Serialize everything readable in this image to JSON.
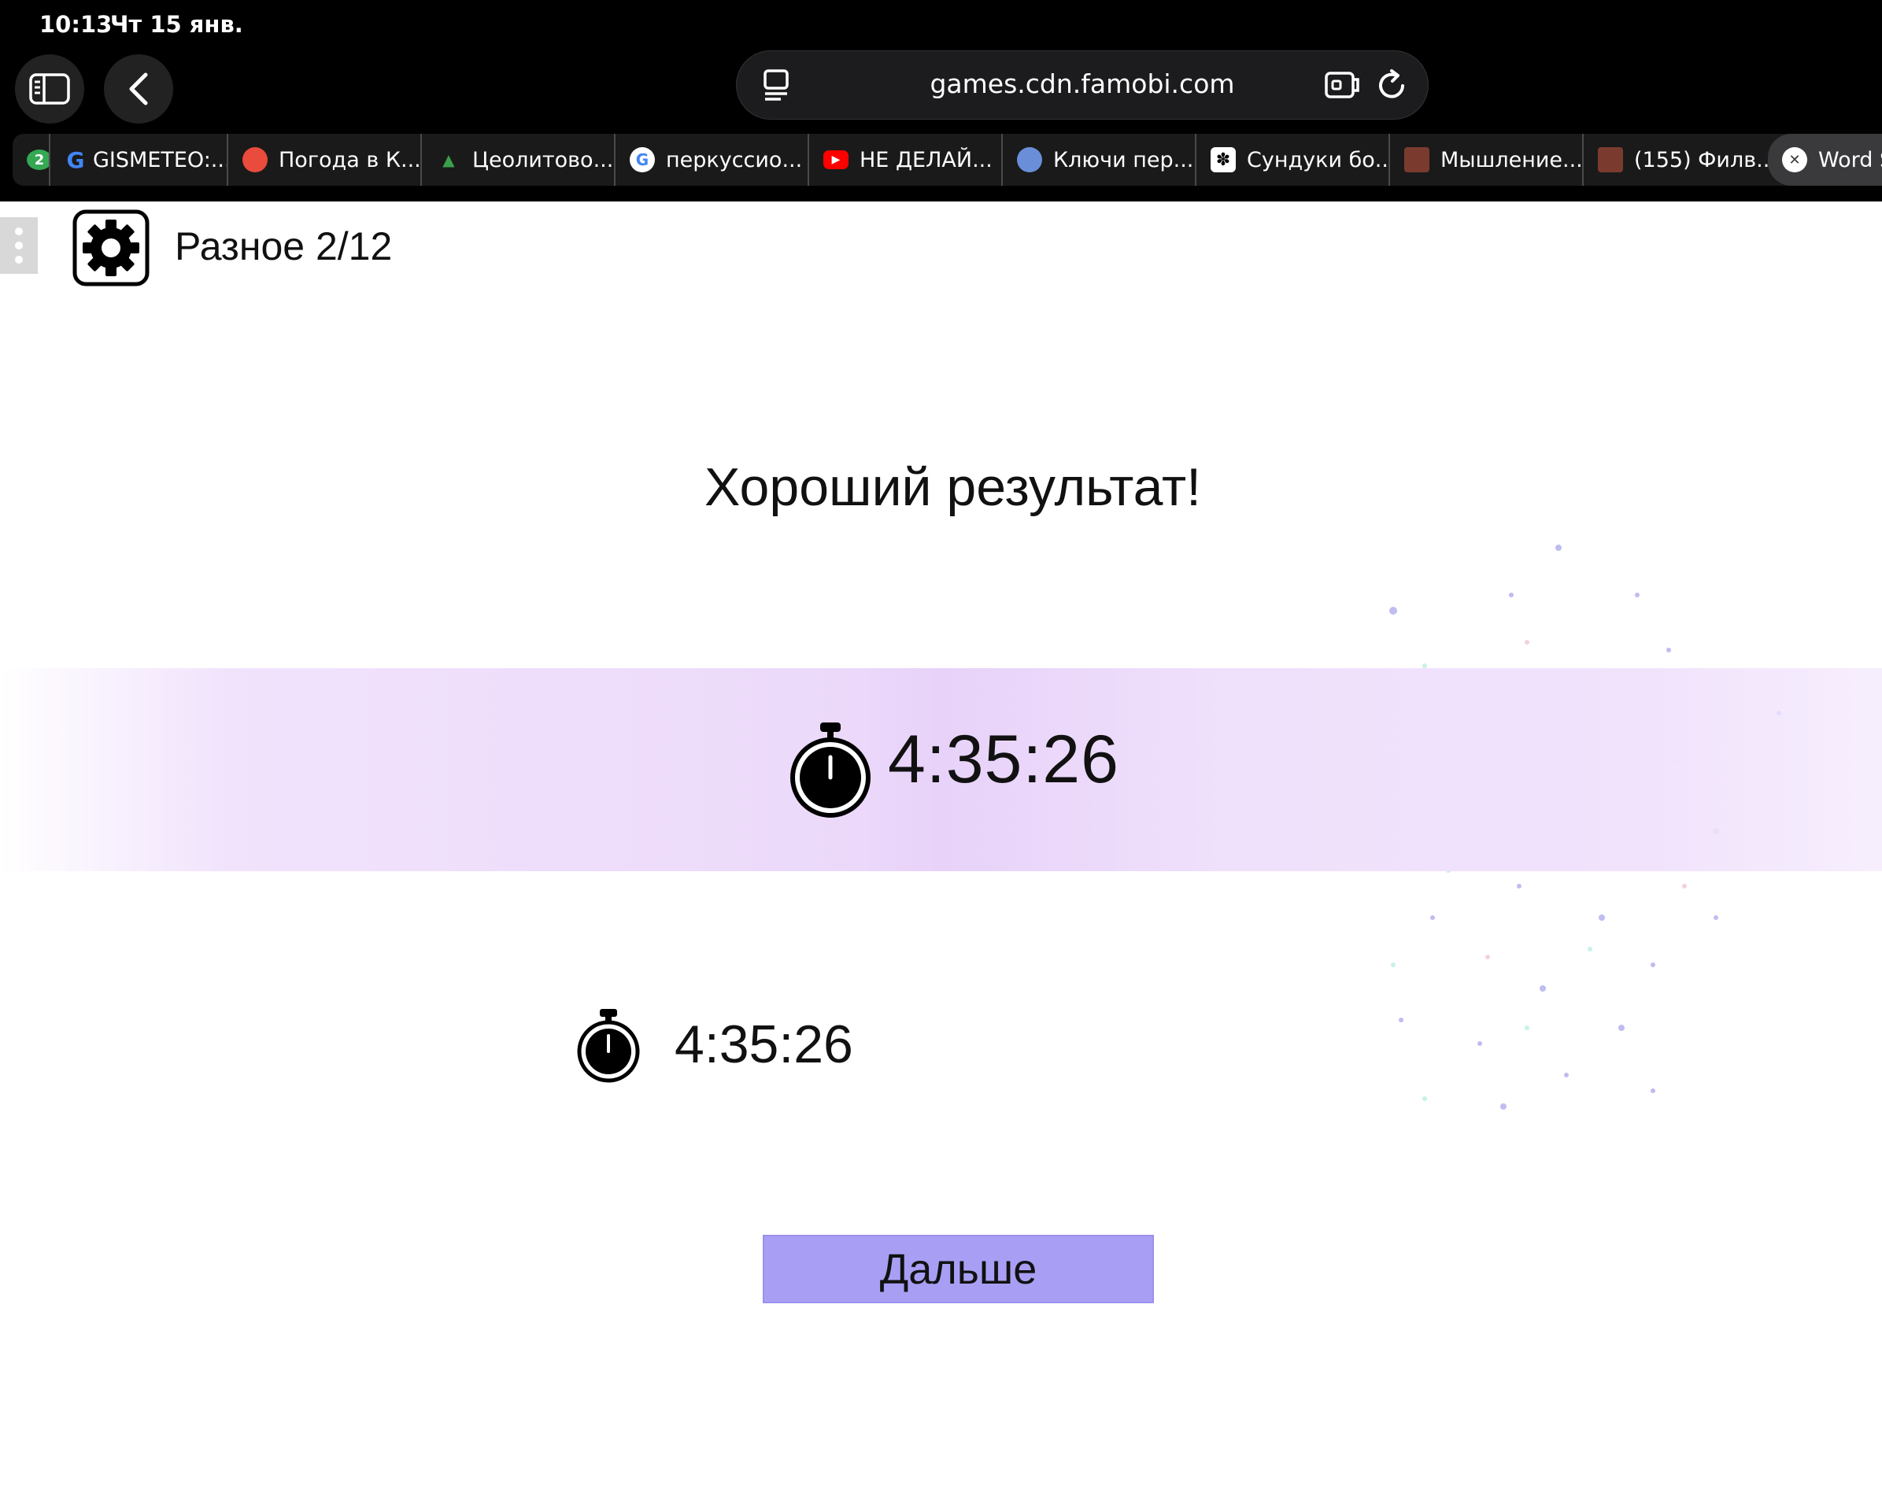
{
  "status_bar": {
    "time": "10:13",
    "date": "Чт 15 янв."
  },
  "address_bar": {
    "url": "games.cdn.famobi.com"
  },
  "tabs": [
    {
      "label": "",
      "badge": "2"
    },
    {
      "label": "GISMETEO:..."
    },
    {
      "label": "Погода в К..."
    },
    {
      "label": "Цеолитово..."
    },
    {
      "label": "перкуссио..."
    },
    {
      "label": "НЕ ДЕЛАЙ..."
    },
    {
      "label": "Ключи пер..."
    },
    {
      "label": "Сундуки бо..."
    },
    {
      "label": "Мышление..."
    },
    {
      "label": "(155) Филв..."
    },
    {
      "label": "Word S"
    }
  ],
  "game": {
    "level_title": "Разное 2/12",
    "result_title": "Хороший результат!",
    "current_time": "4:35:26",
    "best_time": "4:35:26",
    "next_label": "Дальше"
  },
  "colors": {
    "button": "#a89ff4",
    "band": "#ecd9fa",
    "chrome": "#000000"
  }
}
